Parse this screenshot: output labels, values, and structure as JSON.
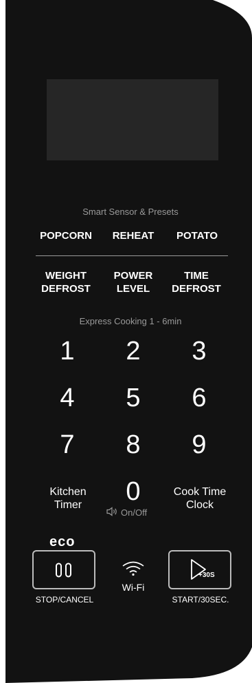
{
  "panel": {
    "background_color": "#121212",
    "display_color": "#262626"
  },
  "presets": {
    "caption": "Smart Sensor & Presets",
    "popcorn": "POPCORN",
    "reheat": "REHEAT",
    "potato": "POTATO",
    "weight_defrost": [
      "WEIGHT",
      "DEFROST"
    ],
    "power_level": [
      "POWER",
      "LEVEL"
    ],
    "time_defrost": [
      "TIME",
      "DEFROST"
    ]
  },
  "keypad": {
    "caption": "Express Cooking 1 - 6min",
    "digits": [
      "1",
      "2",
      "3",
      "4",
      "5",
      "6",
      "7",
      "8",
      "9",
      "0"
    ],
    "kitchen_timer": [
      "Kitchen",
      "Timer"
    ],
    "cook_time_clock": [
      "Cook Time",
      "Clock"
    ],
    "sound_label": "On/Off",
    "sound_icon": "speaker-icon"
  },
  "controls": {
    "eco_label": "eco",
    "stop_icon": "pause-icon",
    "stop_label": "STOP/CANCEL",
    "wifi_icon": "wifi-icon",
    "wifi_label": "Wi-Fi",
    "start_icon_text": "+30S",
    "start_label": "START/30SEC."
  }
}
